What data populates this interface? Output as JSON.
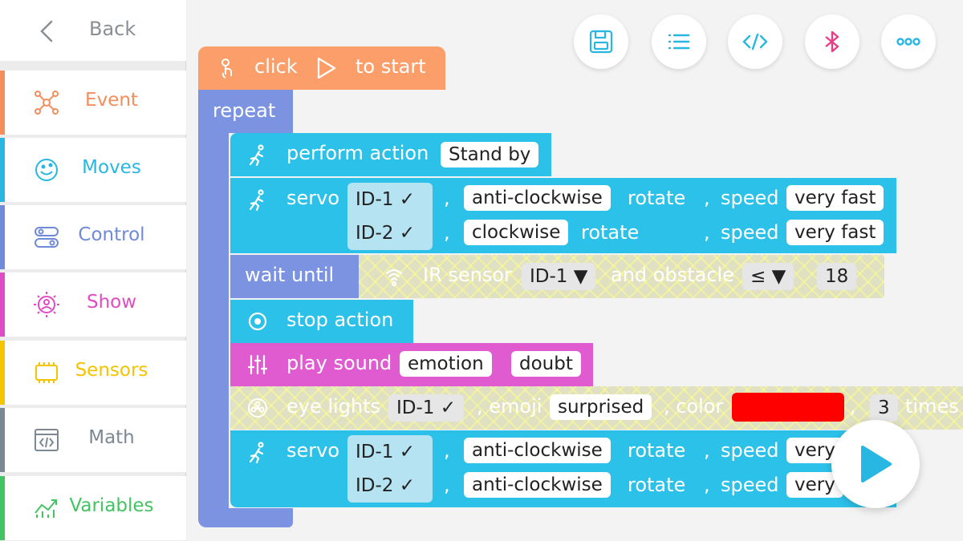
{
  "sidebar": {
    "back_label": "Back",
    "categories": [
      {
        "label": "Event",
        "color": "#f58d5c"
      },
      {
        "label": "Moves",
        "color": "#27b7e2"
      },
      {
        "label": "Control",
        "color": "#6f8ad9"
      },
      {
        "label": "Show",
        "color": "#e04cc3"
      },
      {
        "label": "Sensors",
        "color": "#f5c400"
      },
      {
        "label": "Math",
        "color": "#7c8893"
      },
      {
        "label": "Variables",
        "color": "#43c463"
      }
    ]
  },
  "toolbar": {
    "buttons": [
      "save-icon",
      "list-icon",
      "code-icon",
      "bluetooth-icon",
      "more-icon"
    ]
  },
  "program": {
    "start": {
      "click": "click",
      "to_start": "to start"
    },
    "repeat": "repeat",
    "perform_action": {
      "label": "perform action",
      "value": "Stand by"
    },
    "servo1": {
      "label": "servo",
      "rows": [
        {
          "id": "ID-1 ✓",
          "direction": "anti-clockwise",
          "rotate": "rotate",
          "speed_label": "speed",
          "speed": "very fast"
        },
        {
          "id": "ID-2 ✓",
          "direction": "clockwise",
          "rotate": "rotate",
          "speed_label": "speed",
          "speed": "very fast"
        }
      ]
    },
    "wait_until": {
      "label": "wait until",
      "sensor": "IR sensor",
      "id": "ID-1 ▼",
      "and_obstacle": "and obstacle",
      "op": "≤ ▼",
      "value": "18"
    },
    "stop_action": "stop action",
    "play_sound": {
      "label": "play sound",
      "category": "emotion",
      "sound": "doubt"
    },
    "eye_lights": {
      "label": "eye lights",
      "id": "ID-1 ✓",
      "emoji_label": ", emoji",
      "emoji": "surprised",
      "color_label": ", color",
      "color": "#ff0000",
      "count": "3",
      "times": "times"
    },
    "servo2": {
      "label": "servo",
      "rows": [
        {
          "id": "ID-1 ✓",
          "direction": "anti-clockwise",
          "rotate": "rotate",
          "speed_label": "speed",
          "speed": "very"
        },
        {
          "id": "ID-2 ✓",
          "direction": "anti-clockwise",
          "rotate": "rotate",
          "speed_label": "speed",
          "speed": "very"
        }
      ]
    },
    "comma": ","
  },
  "colors": {
    "event": "#fb9e6a",
    "control": "#7b93e1",
    "moves": "#2cc1e9",
    "show": "#e05bd0"
  }
}
